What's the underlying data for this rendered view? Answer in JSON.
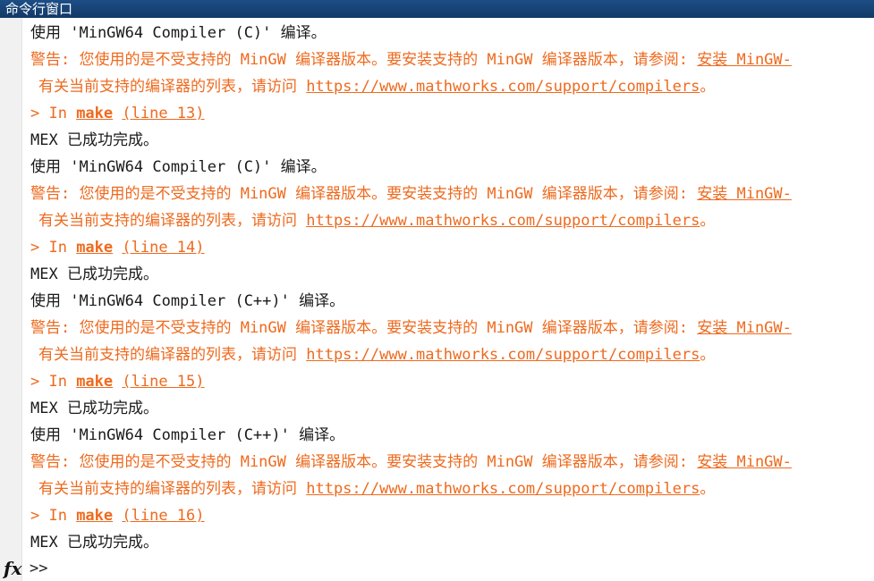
{
  "window": {
    "title": "命令行窗口"
  },
  "console": {
    "blocks": [
      {
        "using": "使用 'MinGW64 Compiler (C)' 编译。",
        "warning_prefix": "警告: 您使用的是不受支持的 MinGW 编译器版本。要安装支持的 MinGW 编译器版本，请参阅: ",
        "install_link": "安装 MinGW-",
        "list_prefix": "有关当前支持的编译器的列表，请访问 ",
        "url": "https://www.mathworks.com/support/compilers",
        "url_suffix": "。",
        "in_prefix": "> In ",
        "func": "make",
        "line_label": "(line 13)",
        "done": "MEX 已成功完成。"
      },
      {
        "using": "使用 'MinGW64 Compiler (C)' 编译。",
        "warning_prefix": "警告: 您使用的是不受支持的 MinGW 编译器版本。要安装支持的 MinGW 编译器版本，请参阅: ",
        "install_link": "安装 MinGW-",
        "list_prefix": "有关当前支持的编译器的列表，请访问 ",
        "url": "https://www.mathworks.com/support/compilers",
        "url_suffix": "。",
        "in_prefix": "> In ",
        "func": "make",
        "line_label": "(line 14)",
        "done": "MEX 已成功完成。"
      },
      {
        "using": "使用 'MinGW64 Compiler (C++)' 编译。",
        "warning_prefix": "警告: 您使用的是不受支持的 MinGW 编译器版本。要安装支持的 MinGW 编译器版本，请参阅: ",
        "install_link": "安装 MinGW-",
        "list_prefix": "有关当前支持的编译器的列表，请访问 ",
        "url": "https://www.mathworks.com/support/compilers",
        "url_suffix": "。",
        "in_prefix": "> In ",
        "func": "make",
        "line_label": "(line 15)",
        "done": "MEX 已成功完成。"
      },
      {
        "using": "使用 'MinGW64 Compiler (C++)' 编译。",
        "warning_prefix": "警告: 您使用的是不受支持的 MinGW 编译器版本。要安装支持的 MinGW 编译器版本，请参阅: ",
        "install_link": "安装 MinGW-",
        "list_prefix": "有关当前支持的编译器的列表，请访问 ",
        "url": "https://www.mathworks.com/support/compilers",
        "url_suffix": "。",
        "in_prefix": "> In ",
        "func": "make",
        "line_label": "(line 16)",
        "done": "MEX 已成功完成。"
      }
    ],
    "prompt": ">>",
    "fx_icon": "fx"
  },
  "colors": {
    "title_bar": "#1d4e86",
    "warning": "#ee6a1e",
    "text": "#1a1a1a"
  }
}
